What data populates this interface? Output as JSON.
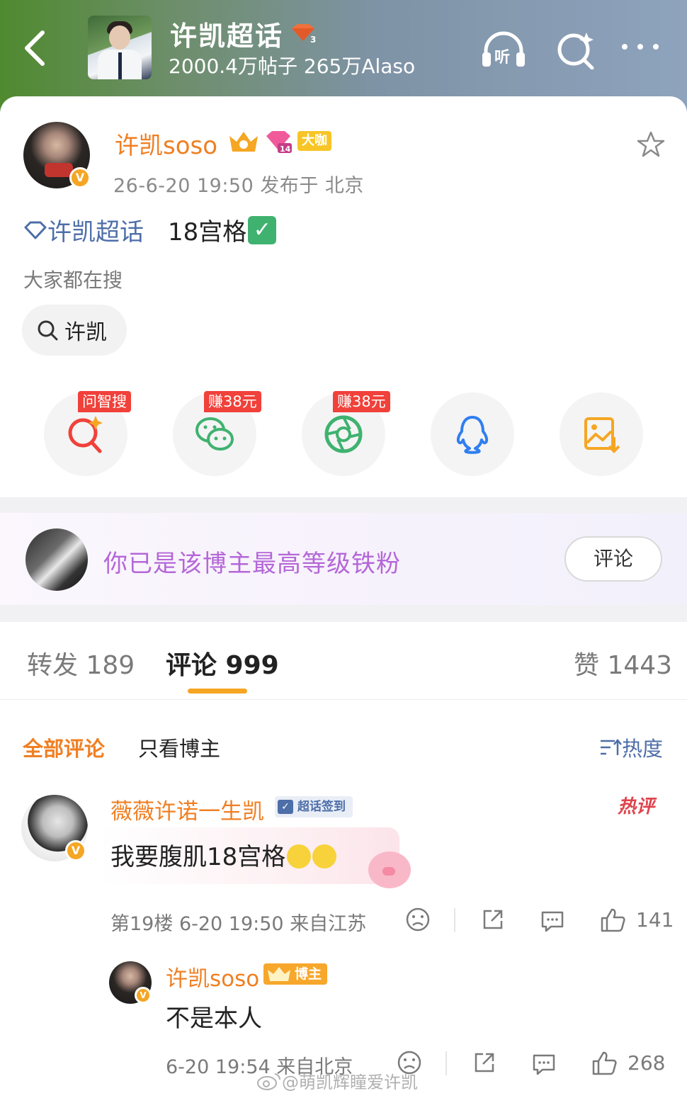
{
  "header": {
    "topic_title": "许凯超话",
    "topic_level": "3",
    "topic_stats": "2000.4万帖子 265万Alaso",
    "listen_label": "听"
  },
  "post": {
    "author": "许凯soso",
    "level_badge": "14",
    "daka_label": "大咖",
    "meta": "26-6-20 19:50  发布于 北京",
    "topic_link": "许凯超话",
    "body": "18宫格",
    "check_mark": "✓",
    "search_hint": "大家都在搜",
    "search_chip": "许凯"
  },
  "share": {
    "buttons": [
      {
        "name": "wenzhisou",
        "tag": "问智搜"
      },
      {
        "name": "wechat",
        "tag": "赚38元"
      },
      {
        "name": "moments",
        "tag": "赚38元"
      },
      {
        "name": "qq",
        "tag": ""
      },
      {
        "name": "save-image",
        "tag": ""
      }
    ]
  },
  "fan_banner": {
    "text": "你已是该博主最高等级铁粉",
    "button": "评论"
  },
  "tabs": {
    "repost": "转发 189",
    "comments": "评论 999",
    "likes": "赞 1443"
  },
  "filters": {
    "all": "全部评论",
    "author_only": "只看博主",
    "sort": "热度"
  },
  "comments": [
    {
      "name": "薇薇许诺一生凯",
      "tag": "超话签到",
      "hot": "热评",
      "text": "我要腹肌18宫格",
      "meta": "第19楼  6-20 19:50  来自江苏",
      "likes": "141"
    }
  ],
  "reply": {
    "name": "许凯soso",
    "tag": "博主",
    "text": "不是本人",
    "meta": "6-20 19:54  来自北京",
    "likes": "268"
  },
  "watermark": "@萌凯辉瞳爱许凯",
  "colors": {
    "accent_orange": "#f07f22",
    "link_blue": "#4d6ea8",
    "fan_purple": "#b467d8",
    "tag_red": "#f0413a"
  }
}
